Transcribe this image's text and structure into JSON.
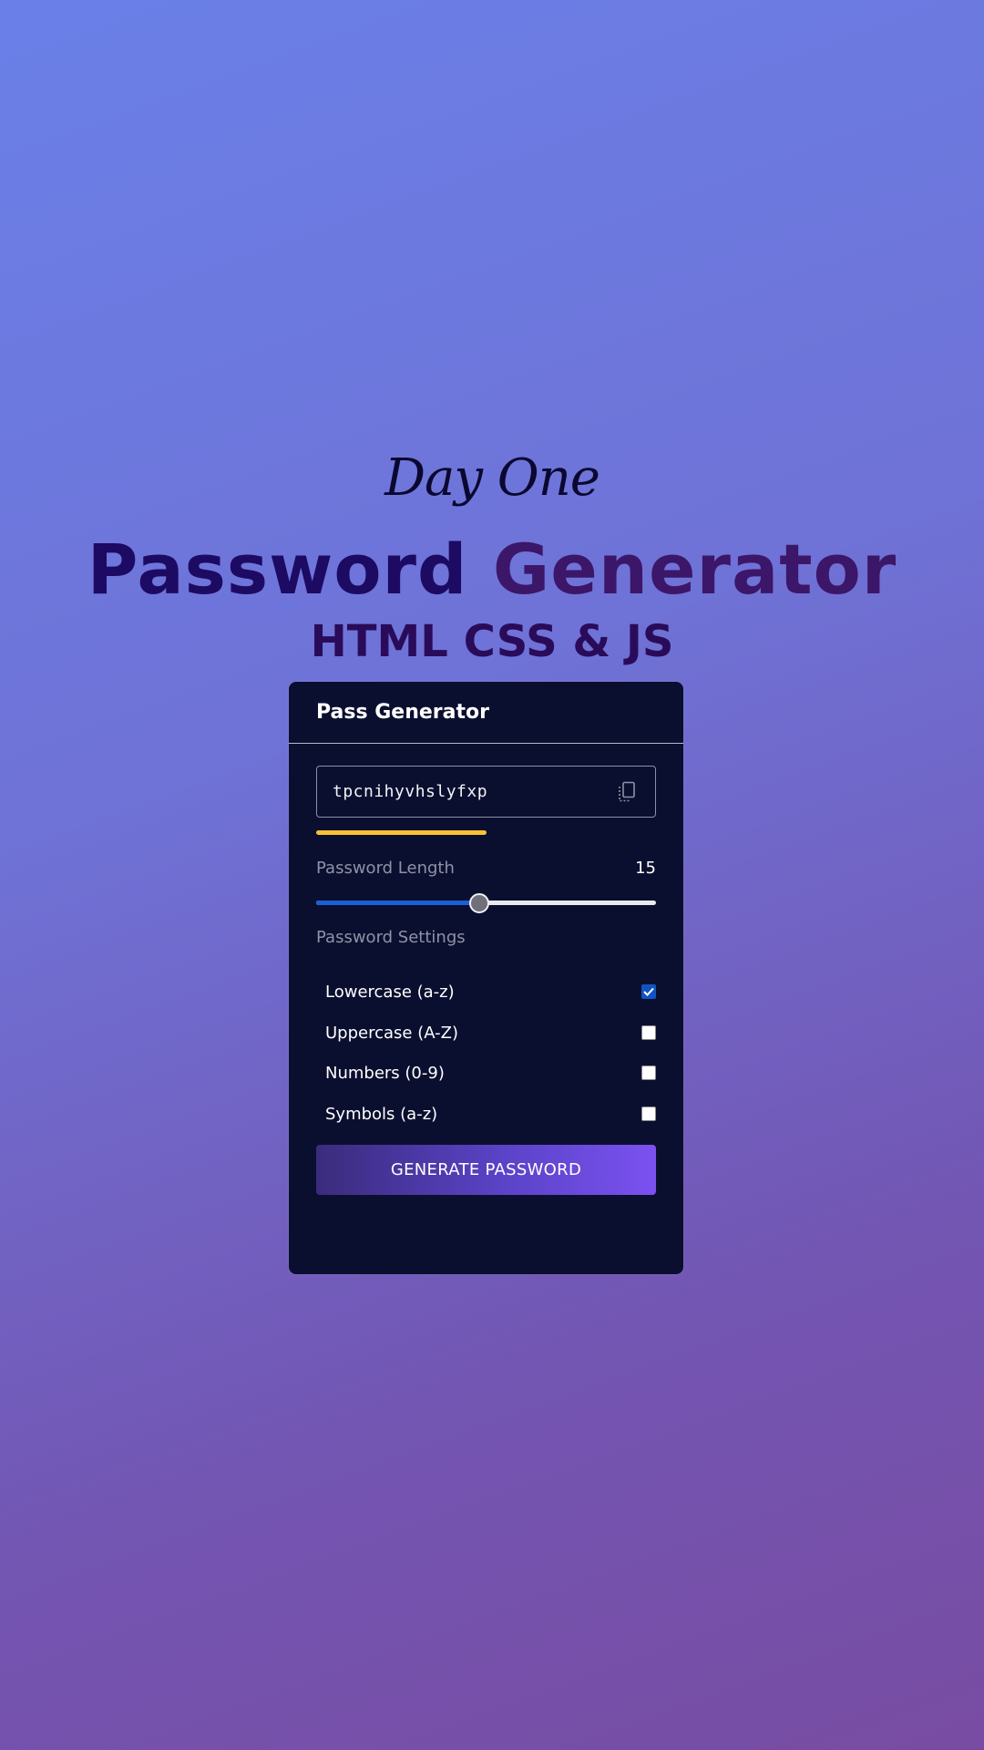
{
  "hero": {
    "kicker": "Day One",
    "title_part1": "Password",
    "title_part2": "Generator",
    "subtitle": "HTML CSS & JS"
  },
  "card": {
    "title": "Pass Generator",
    "password_value": "tpcnihyvhslyfxp",
    "copy_icon": "copy-icon",
    "strength_fraction": 0.5,
    "strength_color": "#f6c234",
    "length_label": "Password Length",
    "length_value": "15",
    "slider_fraction": 0.48,
    "settings_label": "Password Settings",
    "options": [
      {
        "label": "Lowercase (a-z)",
        "checked": true
      },
      {
        "label": "Uppercase (A-Z)",
        "checked": false
      },
      {
        "label": "Numbers (0-9)",
        "checked": false
      },
      {
        "label": "Symbols (a-z)",
        "checked": false
      }
    ],
    "generate_label": "GENERATE PASSWORD"
  },
  "colors": {
    "card_bg": "#0b0f2f",
    "accent_blue": "#1d5fd6",
    "button_gradient_start": "#3a2c7c",
    "button_gradient_end": "#7b51f0"
  }
}
